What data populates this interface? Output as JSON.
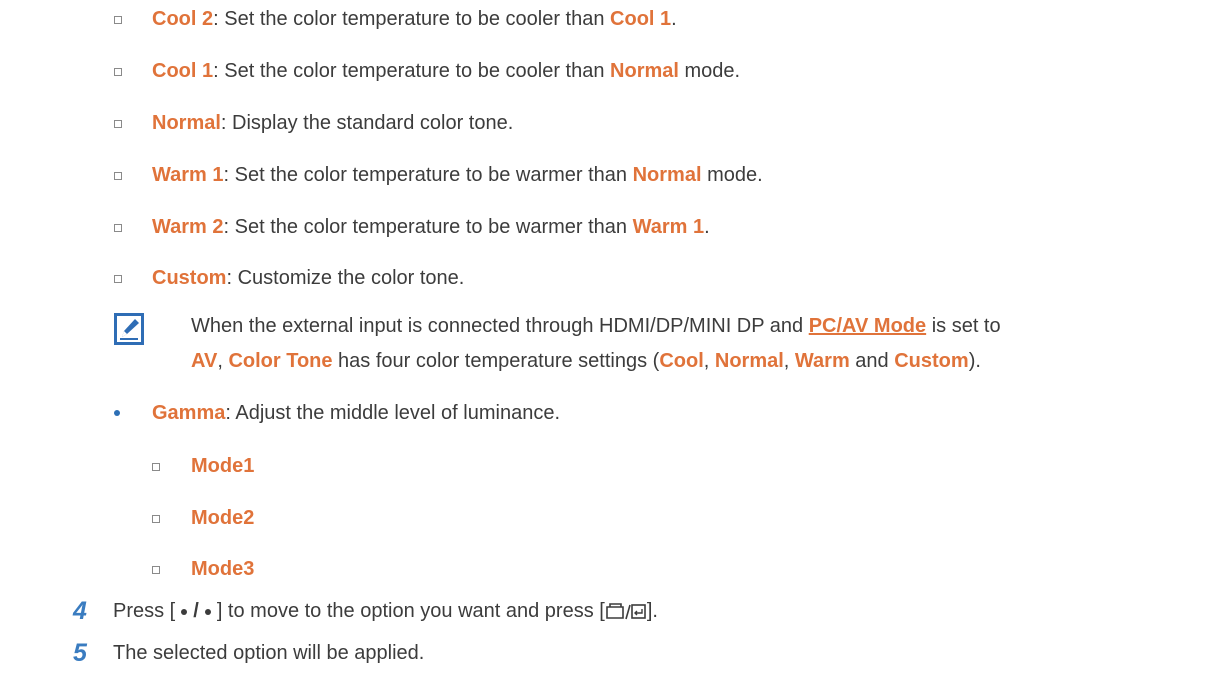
{
  "colors": {
    "keyword": "#e0733a",
    "text": "#3c3c3c",
    "step_number": "#3a7cc0",
    "bullet": "#2c6fb5"
  },
  "tone_items": [
    {
      "term": "Cool 2",
      "text": ": Set the color temperature to be cooler than ",
      "ref": "Cool 1",
      "tail": "."
    },
    {
      "term": "Cool 1",
      "text": ": Set the color temperature to be cooler than ",
      "ref": "Normal",
      "tail": " mode."
    },
    {
      "term": "Normal",
      "text": ": Display the standard color tone.",
      "ref": "",
      "tail": ""
    },
    {
      "term": "Warm 1",
      "text": ": Set the color temperature to be warmer than ",
      "ref": "Normal",
      "tail": " mode."
    },
    {
      "term": "Warm 2",
      "text": ": Set the color temperature to be warmer than ",
      "ref": "Warm 1",
      "tail": "."
    },
    {
      "term": "Custom",
      "text": ": Customize the color tone.",
      "ref": "",
      "tail": ""
    }
  ],
  "note": {
    "icon": "note-pencil-icon",
    "line1_a": "When the external input is connected through HDMI/DP/MINI DP and ",
    "line1_link": "PC/AV Mode",
    "line1_b": " is set to",
    "line2_av": "AV",
    "line2_sep1": ", ",
    "line2_tone": "Color Tone",
    "line2_mid": " has four color temperature settings (",
    "opt_cool": "Cool",
    "sep_a": ", ",
    "opt_normal": "Normal",
    "sep_b": ", ",
    "opt_warm": "Warm",
    "sep_and": " and ",
    "opt_custom": "Custom",
    "line2_end": ")."
  },
  "gamma": {
    "term": "Gamma",
    "text": ": Adjust the middle level of luminance.",
    "modes": [
      "Mode1",
      "Mode2",
      "Mode3"
    ]
  },
  "steps": [
    {
      "num": "4",
      "a": "Press [",
      "b": "] to move to the option you want and press [",
      "c": "]."
    },
    {
      "num": "5",
      "text": "The selected option will be applied."
    }
  ]
}
